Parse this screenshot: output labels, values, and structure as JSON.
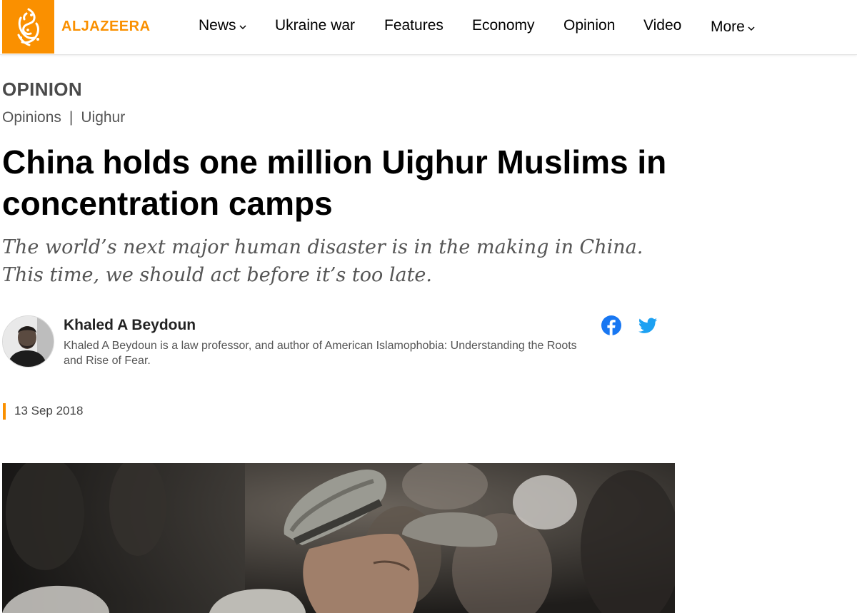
{
  "header": {
    "brand": "ALJAZEERA",
    "brand_color": "#fa9000",
    "nav": [
      {
        "label": "News",
        "dropdown": true
      },
      {
        "label": "Ukraine war",
        "dropdown": false
      },
      {
        "label": "Features",
        "dropdown": false
      },
      {
        "label": "Economy",
        "dropdown": false
      },
      {
        "label": "Opinion",
        "dropdown": false
      },
      {
        "label": "Video",
        "dropdown": false
      },
      {
        "label": "More",
        "dropdown": true
      }
    ]
  },
  "article": {
    "kicker": "OPINION",
    "breadcrumbs": [
      "Opinions",
      "Uighur"
    ],
    "breadcrumb_separator": "|",
    "headline": "China holds one million Uighur Muslims in concentration camps",
    "dek": "The world’s next major human disaster is in the making in China. This time, we should act before it’s too late.",
    "author": {
      "name": "Khaled A Beydoun",
      "bio": "Khaled A Beydoun is a law professor, and author of American Islamophobia: Understanding the Roots and Rise of Fear."
    },
    "share": [
      "facebook-icon",
      "twitter-icon"
    ],
    "date": "13 Sep 2018"
  },
  "colors": {
    "accent": "#fa9000",
    "facebook": "#1877f2",
    "twitter": "#1da1f2"
  }
}
